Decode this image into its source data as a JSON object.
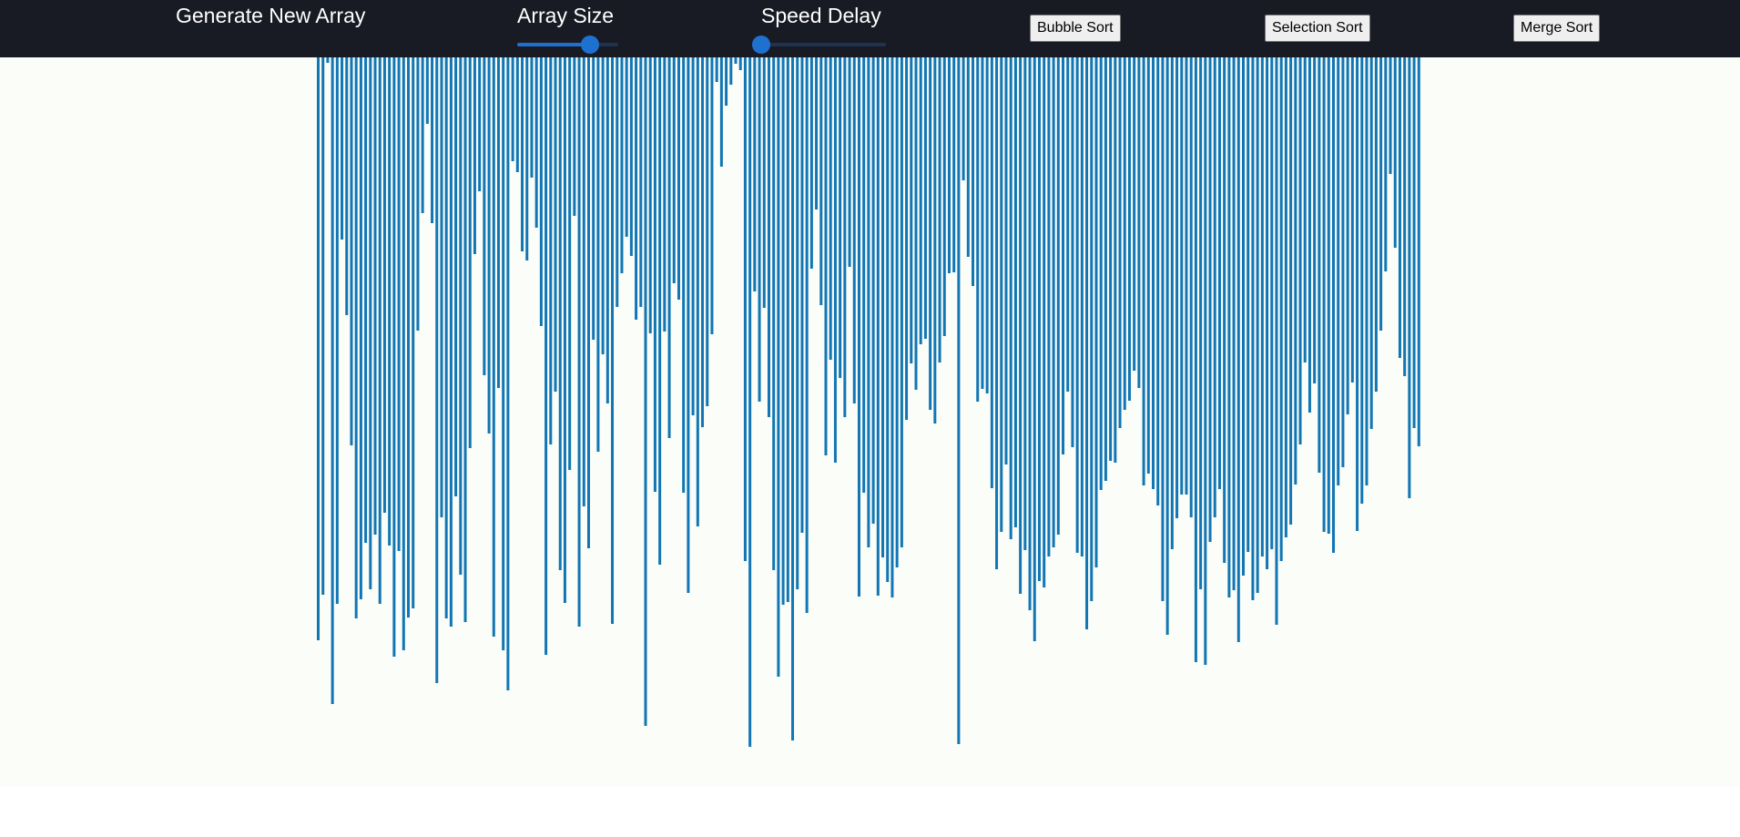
{
  "toolbar": {
    "generate_label": "Generate New Array",
    "array_size": {
      "label": "Array Size",
      "value_fraction": 0.72
    },
    "speed_delay": {
      "label": "Speed Delay",
      "value_fraction": 0.0
    },
    "bubble_sort_label": "Bubble Sort",
    "selection_sort_label": "Selection Sort",
    "merge_sort_label": "Merge Sort"
  },
  "colors": {
    "navbar_bg": "#181a24",
    "navbar_text": "#ffffff",
    "slider_accent": "#1f71d0",
    "slider_track": "#1f3350",
    "bar": "#1176b3",
    "array_bg": "#fbfdf9"
  },
  "array": {
    "values": [
      640,
      590,
      6,
      710,
      600,
      200,
      283,
      426,
      616,
      595,
      533,
      584,
      524,
      600,
      500,
      536,
      658,
      542,
      651,
      615,
      605,
      300,
      171,
      73,
      182,
      687,
      505,
      616,
      625,
      482,
      568,
      620,
      429,
      216,
      147,
      349,
      413,
      636,
      363,
      651,
      695,
      114,
      126,
      213,
      223,
      132,
      187,
      295,
      656,
      425,
      367,
      563,
      599,
      453,
      174,
      625,
      493,
      539,
      310,
      433,
      326,
      380,
      622,
      274,
      237,
      197,
      218,
      288,
      274,
      734,
      303,
      477,
      557,
      301,
      418,
      248,
      266,
      478,
      588,
      393,
      515,
      406,
      383,
      304,
      27,
      120,
      53,
      30,
      7,
      14,
      553,
      757,
      257,
      378,
      275,
      395,
      563,
      680,
      601,
      598,
      750,
      584,
      522,
      610,
      232,
      167,
      272,
      437,
      332,
      445,
      352,
      395,
      230,
      380,
      592,
      478,
      538,
      512,
      591,
      549,
      576,
      593,
      560,
      538,
      398,
      336,
      365,
      315,
      309,
      387,
      402,
      335,
      306,
      237,
      236,
      754,
      135,
      219,
      251,
      378,
      364,
      369,
      473,
      562,
      521,
      447,
      529,
      516,
      589,
      541,
      607,
      641,
      575,
      582,
      548,
      538,
      524,
      436,
      367,
      428,
      544,
      548,
      628,
      597,
      560,
      475,
      465,
      443,
      445,
      407,
      387,
      377,
      344,
      363,
      470,
      457,
      474,
      492,
      597,
      634,
      540,
      506,
      480,
      480,
      505,
      664,
      584,
      667,
      532,
      505,
      474,
      555,
      593,
      585,
      642,
      569,
      543,
      596,
      588,
      548,
      562,
      540,
      623,
      553,
      527,
      513,
      469,
      425,
      335,
      390,
      358,
      456,
      521,
      523,
      544,
      470,
      450,
      392,
      357,
      520,
      490,
      470,
      408,
      367,
      300,
      235,
      128,
      209,
      330,
      350,
      484,
      407,
      427
    ],
    "max_value": 800
  }
}
